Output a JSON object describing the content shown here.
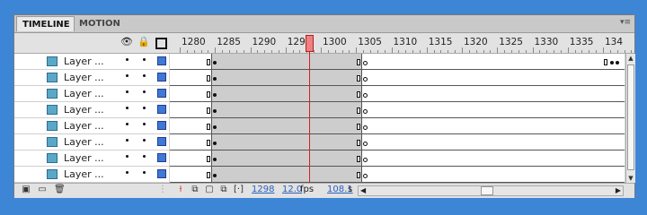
{
  "tabs": [
    {
      "label": "TIMELINE",
      "active": true
    },
    {
      "label": "MOTION EDITOR",
      "active": false
    }
  ],
  "panel_menu_icon": "panel-menu-icon",
  "header": {
    "column_icons": [
      "eye-icon",
      "lock-icon",
      "outline-icon"
    ],
    "ruler_labels": [
      "1280",
      "1285",
      "1290",
      "1295",
      "1300",
      "1305",
      "1310",
      "1315",
      "1320",
      "1325",
      "1330",
      "1335",
      "134"
    ]
  },
  "layers": [
    {
      "name": "Layer ...",
      "eye": "•",
      "lock": "•",
      "color": "#3f78d6"
    },
    {
      "name": "Layer ...",
      "eye": "•",
      "lock": "•",
      "color": "#3f78d6"
    },
    {
      "name": "Layer ...",
      "eye": "•",
      "lock": "•",
      "color": "#3f78d6"
    },
    {
      "name": "Layer ...",
      "eye": "•",
      "lock": "•",
      "color": "#3f78d6"
    },
    {
      "name": "Layer ...",
      "eye": "•",
      "lock": "•",
      "color": "#3f78d6"
    },
    {
      "name": "Layer ...",
      "eye": "•",
      "lock": "•",
      "color": "#3f78d6"
    },
    {
      "name": "Layer ...",
      "eye": "•",
      "lock": "•",
      "color": "#3f78d6"
    },
    {
      "name": "Layer ...",
      "eye": "•",
      "lock": "•",
      "color": "#3f78d6"
    }
  ],
  "playhead_frame": 1298,
  "status": {
    "current_frame": "1298",
    "frame_rate": "12.0",
    "frame_rate_unit": "fps",
    "elapsed_time": "108.1",
    "elapsed_unit": "s"
  },
  "colors": {
    "background": "#3d86d6",
    "playhead": "#d62020",
    "layer_color": "#3f78d6"
  }
}
